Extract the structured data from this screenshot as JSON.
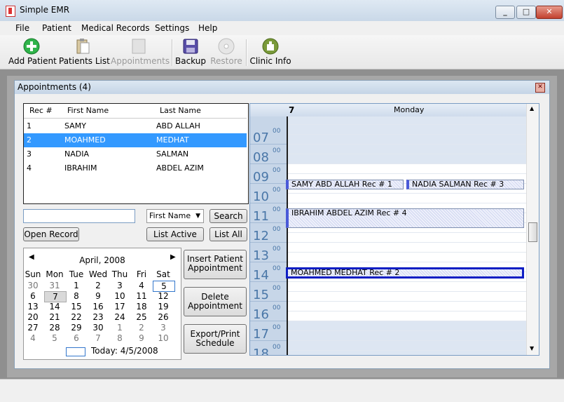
{
  "window": {
    "title": "Simple EMR"
  },
  "menu": [
    "File",
    "Patient",
    "Medical Records",
    "Settings",
    "Help"
  ],
  "toolbar": {
    "add_patient": "Add Patient",
    "patients_list": "Patients List",
    "appointments": "Appointments",
    "backup": "Backup",
    "restore": "Restore",
    "clinic_info": "Clinic Info"
  },
  "appointments_window": {
    "title": "Appointments (4)"
  },
  "patients": {
    "headers": [
      "Rec #",
      "First Name",
      "Last Name"
    ],
    "rows": [
      {
        "rec": "1",
        "first": "SAMY",
        "last": "ABD ALLAH"
      },
      {
        "rec": "2",
        "first": "MOAHMED",
        "last": "MEDHAT"
      },
      {
        "rec": "3",
        "first": "NADIA",
        "last": "SALMAN"
      },
      {
        "rec": "4",
        "first": "IBRAHIM",
        "last": "ABDEL AZIM"
      }
    ],
    "selected_index": 1
  },
  "search": {
    "value": "",
    "field": "First Name",
    "search_label": "Search"
  },
  "buttons": {
    "open_record": "Open Record",
    "list_active": "List Active",
    "list_all": "List All",
    "insert_appointment": "Insert Patient Appointment",
    "delete_appointment": "Delete Appointment",
    "export_print": "Export/Print Schedule"
  },
  "calendar": {
    "month_label": "April, 2008",
    "day_names": [
      "Sun",
      "Mon",
      "Tue",
      "Wed",
      "Thu",
      "Fri",
      "Sat"
    ],
    "weeks": [
      [
        "30",
        "31",
        "1",
        "2",
        "3",
        "4",
        "5"
      ],
      [
        "6",
        "7",
        "8",
        "9",
        "10",
        "11",
        "12"
      ],
      [
        "13",
        "14",
        "15",
        "16",
        "17",
        "18",
        "19"
      ],
      [
        "20",
        "21",
        "22",
        "23",
        "24",
        "25",
        "26"
      ],
      [
        "27",
        "28",
        "29",
        "30",
        "1",
        "2",
        "3"
      ],
      [
        "4",
        "5",
        "6",
        "7",
        "8",
        "9",
        "10"
      ]
    ],
    "selected_day": "7",
    "today_label": "Today: 4/5/2008"
  },
  "schedule": {
    "day_number": "7",
    "day_name": "Monday",
    "hours": [
      "07",
      "08",
      "09",
      "10",
      "11",
      "12",
      "13",
      "14",
      "15",
      "16",
      "17",
      "18"
    ],
    "minutes_label": "00",
    "appointments": [
      {
        "label": "SAMY ABD ALLAH Rec # 1"
      },
      {
        "label": "NADIA SALMAN Rec # 3"
      },
      {
        "label": "IBRAHIM ABDEL AZIM Rec # 4"
      },
      {
        "label": "MOAHMED MEDHAT Rec # 2"
      }
    ]
  },
  "colors": {
    "selection": "#3399ff",
    "accent": "#0f1ec4"
  }
}
